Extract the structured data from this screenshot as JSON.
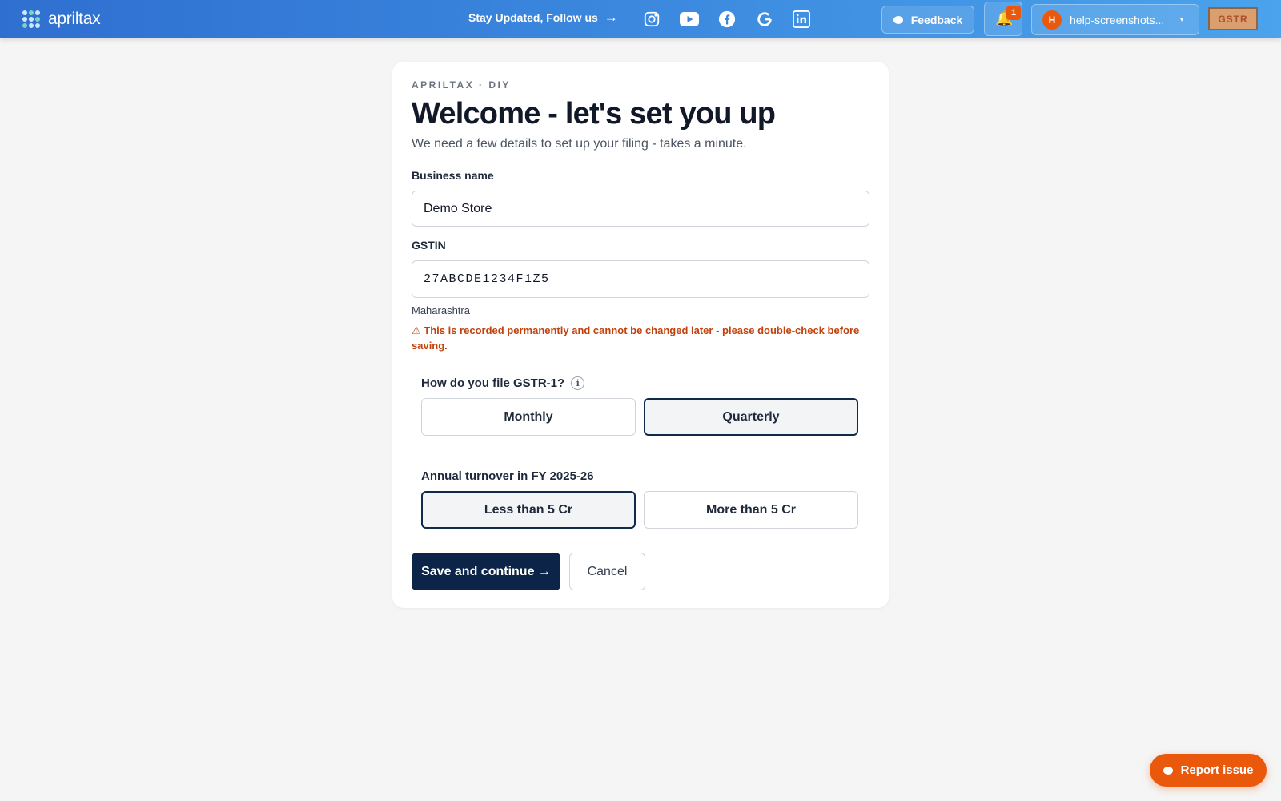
{
  "header": {
    "brand": "apriltax",
    "follow_text": "Stay Updated, Follow us",
    "follow_arrow": "→",
    "social_icons": [
      "instagram-icon",
      "youtube-icon",
      "facebook-icon",
      "google-icon",
      "linkedin-icon"
    ],
    "feedback_label": "Feedback",
    "notification_count": "1",
    "account_initial": "H",
    "account_name": "help-screenshots...",
    "account_caret": "▾",
    "product_chip": "GSTR"
  },
  "card": {
    "eyebrow": "APRILTAX · DIY",
    "title": "Welcome - let's set you up",
    "subtitle": "We need a few details to set up your filing - takes a minute.",
    "business_name": {
      "label": "Business name",
      "value": "Demo Store"
    },
    "gstin": {
      "label": "GSTIN",
      "value": "27ABCDE1234F1Z5",
      "state": "Maharashtra",
      "warning": "⚠ This is recorded permanently and cannot be changed later - please double-check before saving."
    },
    "filing_frequency": {
      "label": "How do you file GSTR-1?",
      "info": "i",
      "options": [
        "Monthly",
        "Quarterly"
      ],
      "selected": "Quarterly"
    },
    "turnover": {
      "label": "Annual turnover in FY 2025-26",
      "options": [
        "Less than 5 Cr",
        "More than 5 Cr"
      ],
      "selected": "Less than 5 Cr"
    },
    "actions": {
      "primary": "Save and continue →",
      "secondary": "Cancel"
    }
  },
  "report_issue": "Report issue",
  "colors": {
    "primary": "#0b2447",
    "accent": "#ea580c",
    "header_start": "#2f6fd0",
    "header_end": "#4aa3ec",
    "warning": "#c2410c"
  }
}
